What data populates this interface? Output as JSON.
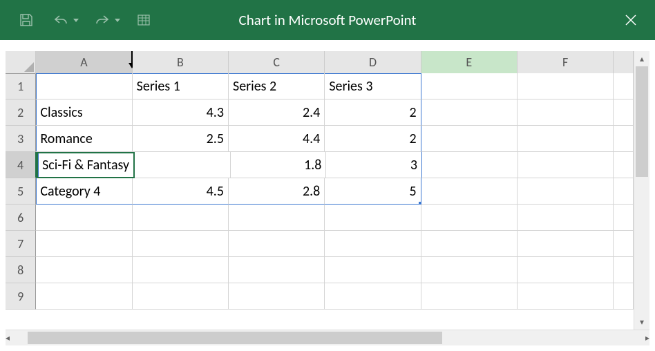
{
  "title": "Chart in Microsoft PowerPoint",
  "qat": {
    "save": "save-icon",
    "undo": "undo-icon",
    "redo": "redo-icon",
    "customize": "customize-grid-icon"
  },
  "columns": [
    "A",
    "B",
    "C",
    "D",
    "E",
    "F"
  ],
  "rows": [
    "1",
    "2",
    "3",
    "4",
    "5",
    "6",
    "7",
    "8",
    "9"
  ],
  "active_cell": "A4",
  "selected_column": "E",
  "editing_value": "Sci-Fi & Fantasy",
  "cells": {
    "B1": "Series 1",
    "C1": "Series 2",
    "D1": "Series 3",
    "A2": "Classics",
    "B2": "4.3",
    "C2": "2.4",
    "D2": "2",
    "A3": "Romance",
    "B3": "2.5",
    "C3": "4.4",
    "D3": "2",
    "A4": "Sci-Fi & Fantasy",
    "C4": "1.8",
    "D4": "3",
    "A5": "Category 4",
    "B5": "4.5",
    "C5": "2.8",
    "D5": "5"
  },
  "chart_data": {
    "type": "bar",
    "categories": [
      "Classics",
      "Romance",
      "Sci-Fi & Fantasy",
      "Category 4"
    ],
    "series": [
      {
        "name": "Series 1",
        "values": [
          4.3,
          2.5,
          null,
          4.5
        ]
      },
      {
        "name": "Series 2",
        "values": [
          2.4,
          4.4,
          1.8,
          2.8
        ]
      },
      {
        "name": "Series 3",
        "values": [
          2,
          2,
          3,
          5
        ]
      }
    ],
    "title": "",
    "xlabel": "",
    "ylabel": ""
  }
}
